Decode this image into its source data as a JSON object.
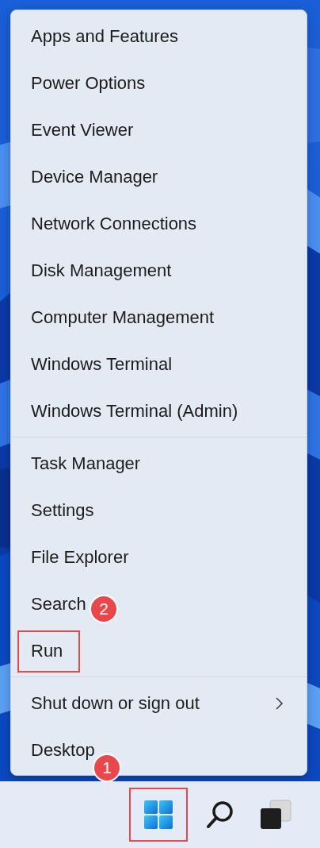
{
  "menu": {
    "groups": [
      {
        "items": [
          {
            "label": "Apps and Features",
            "kind": "item"
          },
          {
            "label": "Power Options",
            "kind": "item"
          },
          {
            "label": "Event Viewer",
            "kind": "item"
          },
          {
            "label": "Device Manager",
            "kind": "item"
          },
          {
            "label": "Network Connections",
            "kind": "item"
          },
          {
            "label": "Disk Management",
            "kind": "item"
          },
          {
            "label": "Computer Management",
            "kind": "item"
          },
          {
            "label": "Windows Terminal",
            "kind": "item"
          },
          {
            "label": "Windows Terminal (Admin)",
            "kind": "item"
          }
        ]
      },
      {
        "items": [
          {
            "label": "Task Manager",
            "kind": "item"
          },
          {
            "label": "Settings",
            "kind": "item"
          },
          {
            "label": "File Explorer",
            "kind": "item"
          },
          {
            "label": "Search",
            "kind": "item"
          },
          {
            "label": "Run",
            "kind": "item",
            "highlighted": true,
            "badge": "2"
          }
        ]
      },
      {
        "items": [
          {
            "label": "Shut down or sign out",
            "kind": "submenu"
          },
          {
            "label": "Desktop",
            "kind": "item"
          }
        ]
      }
    ]
  },
  "taskbar": {
    "buttons": [
      {
        "kind": "start",
        "highlighted": true,
        "badge": "1"
      },
      {
        "kind": "search",
        "highlighted": false
      },
      {
        "kind": "task_view",
        "highlighted": false
      }
    ]
  }
}
